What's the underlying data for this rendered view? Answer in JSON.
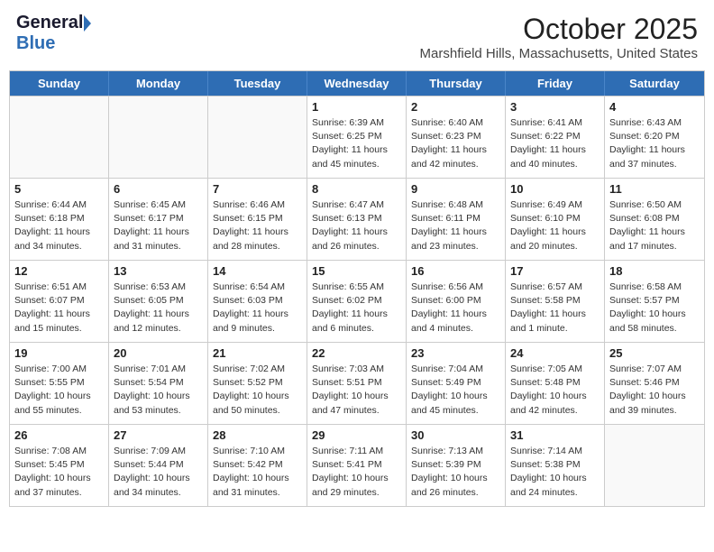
{
  "header": {
    "logo_general": "General",
    "logo_blue": "Blue",
    "month": "October 2025",
    "location": "Marshfield Hills, Massachusetts, United States"
  },
  "weekdays": [
    "Sunday",
    "Monday",
    "Tuesday",
    "Wednesday",
    "Thursday",
    "Friday",
    "Saturday"
  ],
  "rows": [
    [
      {
        "day": "",
        "info": ""
      },
      {
        "day": "",
        "info": ""
      },
      {
        "day": "",
        "info": ""
      },
      {
        "day": "1",
        "info": "Sunrise: 6:39 AM\nSunset: 6:25 PM\nDaylight: 11 hours\nand 45 minutes."
      },
      {
        "day": "2",
        "info": "Sunrise: 6:40 AM\nSunset: 6:23 PM\nDaylight: 11 hours\nand 42 minutes."
      },
      {
        "day": "3",
        "info": "Sunrise: 6:41 AM\nSunset: 6:22 PM\nDaylight: 11 hours\nand 40 minutes."
      },
      {
        "day": "4",
        "info": "Sunrise: 6:43 AM\nSunset: 6:20 PM\nDaylight: 11 hours\nand 37 minutes."
      }
    ],
    [
      {
        "day": "5",
        "info": "Sunrise: 6:44 AM\nSunset: 6:18 PM\nDaylight: 11 hours\nand 34 minutes."
      },
      {
        "day": "6",
        "info": "Sunrise: 6:45 AM\nSunset: 6:17 PM\nDaylight: 11 hours\nand 31 minutes."
      },
      {
        "day": "7",
        "info": "Sunrise: 6:46 AM\nSunset: 6:15 PM\nDaylight: 11 hours\nand 28 minutes."
      },
      {
        "day": "8",
        "info": "Sunrise: 6:47 AM\nSunset: 6:13 PM\nDaylight: 11 hours\nand 26 minutes."
      },
      {
        "day": "9",
        "info": "Sunrise: 6:48 AM\nSunset: 6:11 PM\nDaylight: 11 hours\nand 23 minutes."
      },
      {
        "day": "10",
        "info": "Sunrise: 6:49 AM\nSunset: 6:10 PM\nDaylight: 11 hours\nand 20 minutes."
      },
      {
        "day": "11",
        "info": "Sunrise: 6:50 AM\nSunset: 6:08 PM\nDaylight: 11 hours\nand 17 minutes."
      }
    ],
    [
      {
        "day": "12",
        "info": "Sunrise: 6:51 AM\nSunset: 6:07 PM\nDaylight: 11 hours\nand 15 minutes."
      },
      {
        "day": "13",
        "info": "Sunrise: 6:53 AM\nSunset: 6:05 PM\nDaylight: 11 hours\nand 12 minutes."
      },
      {
        "day": "14",
        "info": "Sunrise: 6:54 AM\nSunset: 6:03 PM\nDaylight: 11 hours\nand 9 minutes."
      },
      {
        "day": "15",
        "info": "Sunrise: 6:55 AM\nSunset: 6:02 PM\nDaylight: 11 hours\nand 6 minutes."
      },
      {
        "day": "16",
        "info": "Sunrise: 6:56 AM\nSunset: 6:00 PM\nDaylight: 11 hours\nand 4 minutes."
      },
      {
        "day": "17",
        "info": "Sunrise: 6:57 AM\nSunset: 5:58 PM\nDaylight: 11 hours\nand 1 minute."
      },
      {
        "day": "18",
        "info": "Sunrise: 6:58 AM\nSunset: 5:57 PM\nDaylight: 10 hours\nand 58 minutes."
      }
    ],
    [
      {
        "day": "19",
        "info": "Sunrise: 7:00 AM\nSunset: 5:55 PM\nDaylight: 10 hours\nand 55 minutes."
      },
      {
        "day": "20",
        "info": "Sunrise: 7:01 AM\nSunset: 5:54 PM\nDaylight: 10 hours\nand 53 minutes."
      },
      {
        "day": "21",
        "info": "Sunrise: 7:02 AM\nSunset: 5:52 PM\nDaylight: 10 hours\nand 50 minutes."
      },
      {
        "day": "22",
        "info": "Sunrise: 7:03 AM\nSunset: 5:51 PM\nDaylight: 10 hours\nand 47 minutes."
      },
      {
        "day": "23",
        "info": "Sunrise: 7:04 AM\nSunset: 5:49 PM\nDaylight: 10 hours\nand 45 minutes."
      },
      {
        "day": "24",
        "info": "Sunrise: 7:05 AM\nSunset: 5:48 PM\nDaylight: 10 hours\nand 42 minutes."
      },
      {
        "day": "25",
        "info": "Sunrise: 7:07 AM\nSunset: 5:46 PM\nDaylight: 10 hours\nand 39 minutes."
      }
    ],
    [
      {
        "day": "26",
        "info": "Sunrise: 7:08 AM\nSunset: 5:45 PM\nDaylight: 10 hours\nand 37 minutes."
      },
      {
        "day": "27",
        "info": "Sunrise: 7:09 AM\nSunset: 5:44 PM\nDaylight: 10 hours\nand 34 minutes."
      },
      {
        "day": "28",
        "info": "Sunrise: 7:10 AM\nSunset: 5:42 PM\nDaylight: 10 hours\nand 31 minutes."
      },
      {
        "day": "29",
        "info": "Sunrise: 7:11 AM\nSunset: 5:41 PM\nDaylight: 10 hours\nand 29 minutes."
      },
      {
        "day": "30",
        "info": "Sunrise: 7:13 AM\nSunset: 5:39 PM\nDaylight: 10 hours\nand 26 minutes."
      },
      {
        "day": "31",
        "info": "Sunrise: 7:14 AM\nSunset: 5:38 PM\nDaylight: 10 hours\nand 24 minutes."
      },
      {
        "day": "",
        "info": ""
      }
    ]
  ]
}
